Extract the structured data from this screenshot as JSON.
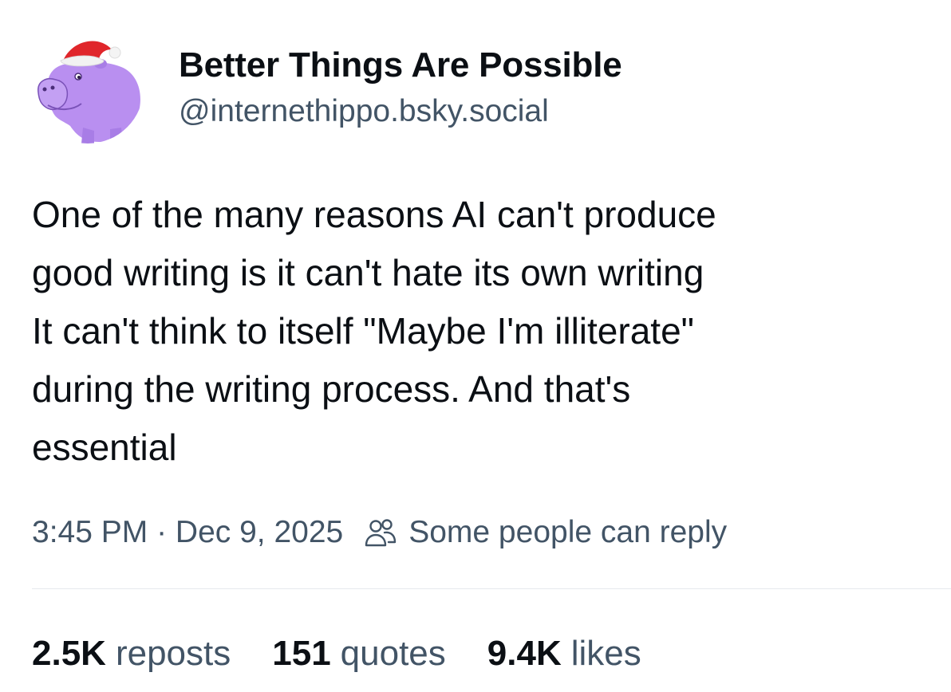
{
  "author": {
    "display_name": "Better Things Are Possible",
    "handle": "@internethippo.bsky.social",
    "avatar_icon": "hippo-santa-hat-avatar"
  },
  "post": {
    "text_lines": [
      "One of the many reasons AI can't produce",
      "good writing is it can't hate its own writing",
      "It can't think to itself \"Maybe I'm illiterate\"",
      "during the writing process. And that's",
      "essential"
    ]
  },
  "meta": {
    "timestamp": "3:45 PM · Dec 9, 2025",
    "reply_setting": "Some people can reply",
    "reply_icon": "people-icon"
  },
  "stats": {
    "reposts_count": "2.5K",
    "reposts_label": "reposts",
    "quotes_count": "151",
    "quotes_label": "quotes",
    "likes_count": "9.4K",
    "likes_label": "likes"
  },
  "colors": {
    "text_primary": "#0b0f14",
    "text_secondary": "#425466",
    "avatar_purple": "#b98ff0",
    "hat_red": "#e0262b"
  }
}
